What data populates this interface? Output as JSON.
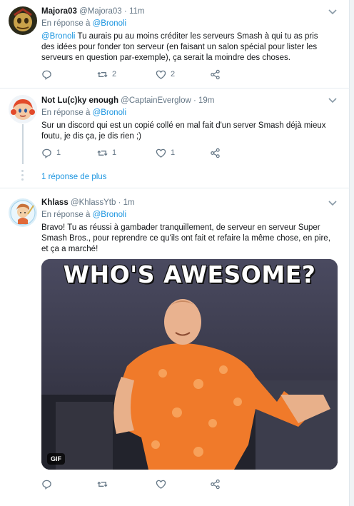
{
  "tweets": [
    {
      "name": "Majora03",
      "handle": "@Majora03",
      "separator": "·",
      "time": "11m",
      "reply_prefix": "",
      "reply_mention": "",
      "text_mention": "@Bronoli",
      "text": " Tu aurais pu au moins créditer les serveurs Smash à qui tu as pris des idées pour fonder ton serveur (en faisant un salon spécial pour lister les serveurs en question par-exemple), ça serait la moindre des choses.",
      "replies": "",
      "retweets": "2",
      "likes": "2",
      "avatar_color": "#2b2a1a"
    },
    {
      "name": "Not Lu(c)ky enough",
      "handle": "@CaptainEverglow",
      "separator": "·",
      "time": "19m",
      "reply_prefix": "En réponse à ",
      "reply_mention": "@Bronoli",
      "text_mention": "",
      "text": "Sur un discord qui est un copié collé en mal fait d'un server Smash déjà mieux foutu, je dis ça, je dis rien ;)",
      "replies": "1",
      "retweets": "1",
      "likes": "1",
      "avatar_color": "#f0f4f8"
    },
    {
      "name": "Khlass",
      "handle": "@KhlassYtb",
      "separator": "·",
      "time": "1m",
      "reply_prefix": "En réponse à ",
      "reply_mention": "@Bronoli",
      "text_mention": "",
      "text": "Bravo! Tu as réussi à gambader tranquillement, de serveur en serveur Super Smash Bros., pour reprendre ce qu'ils ont fait et refaire la même chose, en pire, et ça a marché!",
      "replies": "",
      "retweets": "",
      "likes": "",
      "avatar_color": "#dbeef8"
    }
  ],
  "first_reply": {
    "prefix": "En réponse à ",
    "mention": "@Bronoli"
  },
  "more_replies": "1 réponse de plus",
  "gif": {
    "caption": "WHO'S AWESOME?",
    "badge": "GIF"
  },
  "colors": {
    "link": "#1b95e0",
    "muted": "#657786",
    "text": "#14171a",
    "divider": "#e6ecf0"
  },
  "icons": [
    "reply-icon",
    "retweet-icon",
    "like-icon",
    "share-icon",
    "chevron-down-icon"
  ]
}
